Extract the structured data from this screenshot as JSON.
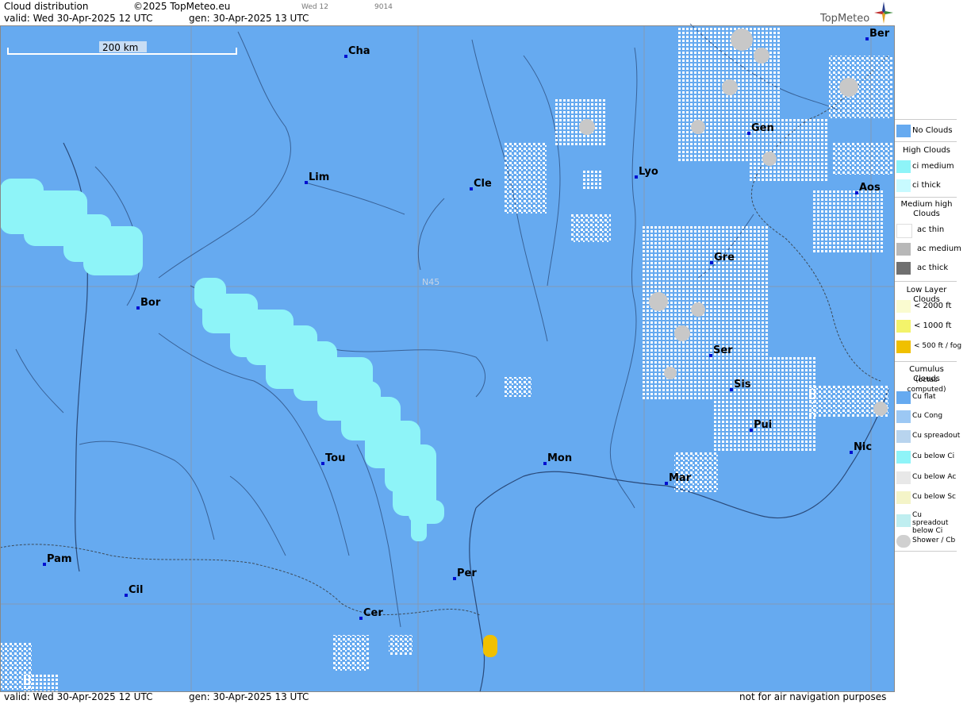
{
  "header": {
    "title": "Cloud distribution",
    "copyright": "©2025 TopMeteo.eu",
    "valid": "valid:  Wed  30-Apr-2025  12 UTC",
    "gen": "gen: 30-Apr-2025 13 UTC",
    "day_small": "Wed 12",
    "code_small": "9014",
    "logo": "TopMeteo"
  },
  "footer": {
    "valid": "valid:  Wed  30-Apr-2025  12 UTC",
    "gen": "gen: 30-Apr-2025 13 UTC",
    "disclaimer": "not for air navigation purposes"
  },
  "map": {
    "scale_label": "200 km",
    "grid_label": "N45",
    "colors": {
      "no_clouds": "#66aaf0",
      "ci_medium": "#8ef4f8",
      "ac": "#ffffff",
      "ac_medium": "#c8c8c8",
      "fog": "#f0c000",
      "border": "#2a4a7a"
    },
    "cities": [
      {
        "name": "Cha"
      },
      {
        "name": "Lim"
      },
      {
        "name": "Cle"
      },
      {
        "name": "Lyo"
      },
      {
        "name": "Gen"
      },
      {
        "name": "Ber"
      },
      {
        "name": "Aos"
      },
      {
        "name": "Gre"
      },
      {
        "name": "Bor"
      },
      {
        "name": "Ser"
      },
      {
        "name": "Sis"
      },
      {
        "name": "Pui"
      },
      {
        "name": "Tou"
      },
      {
        "name": "Mon"
      },
      {
        "name": "Mar"
      },
      {
        "name": "Nic"
      },
      {
        "name": "Pam"
      },
      {
        "name": "Cil"
      },
      {
        "name": "Per"
      },
      {
        "name": "Cer"
      }
    ]
  },
  "legend": {
    "no_clouds": "No Clouds",
    "high_title": "High Clouds",
    "ci_medium": "ci medium",
    "ci_thick": "ci thick",
    "medium_title": "Medium high Clouds",
    "ac_thin": "ac thin",
    "ac_medium": "ac medium",
    "ac_thick": "ac thick",
    "low_title": "Low Layer Clouds",
    "low_2000": "< 2000 ft",
    "low_1000": "< 1000 ft",
    "low_500": "< 500 ft / fog",
    "cu_title": "Cumulus Clouds",
    "cu_subtitle": "(octas computed)",
    "cu_flat": "Cu flat",
    "cu_cong": "Cu Cong",
    "cu_spread": "Cu spreadout",
    "cu_below_ci": "Cu below Ci",
    "cu_below_ac": "Cu below Ac",
    "cu_below_sc": "Cu below Sc",
    "cu_spread_ci": "Cu spreadout below Ci",
    "shower": "Shower / Cb"
  }
}
